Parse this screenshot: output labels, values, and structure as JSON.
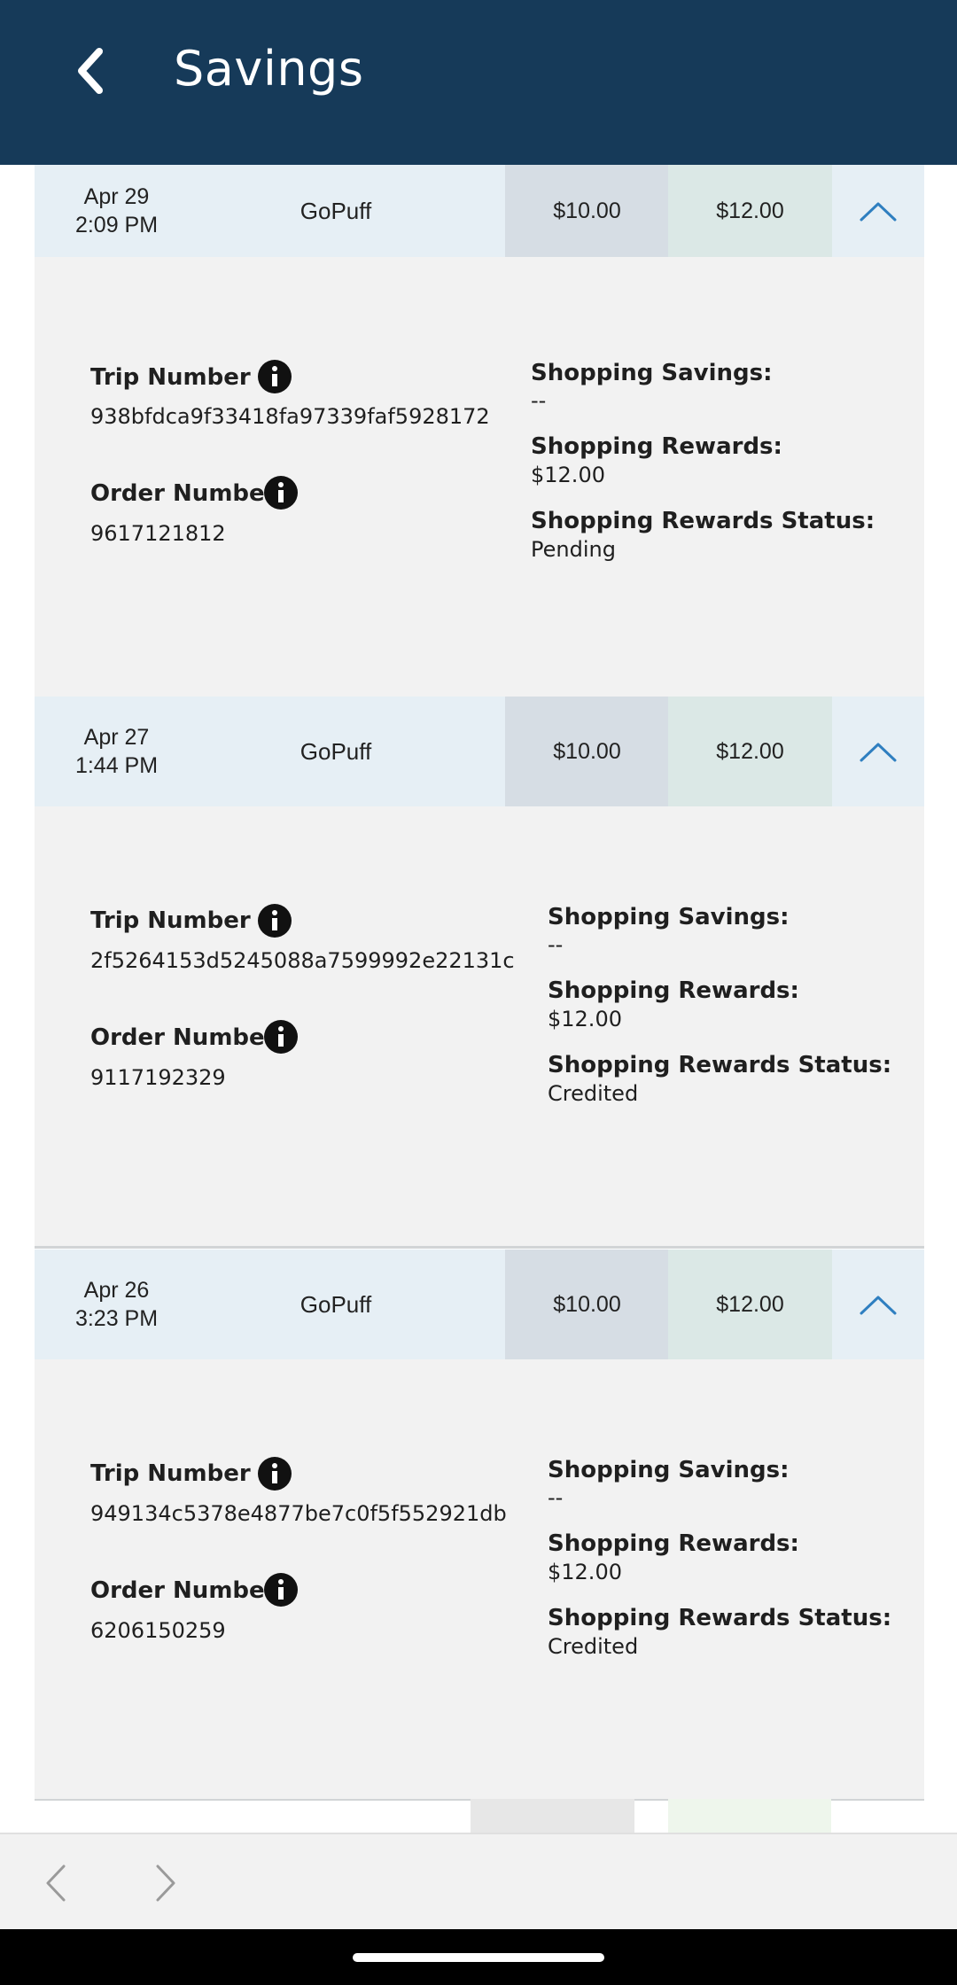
{
  "header": {
    "title": "Savings",
    "back_icon": "chevron-left-icon"
  },
  "trips": [
    {
      "date": "Apr 29",
      "time": "2:09 PM",
      "merchant": "GoPuff",
      "savings_amount": "$10.00",
      "rewards_amount": "$12.00",
      "trip_number_label": "Trip Number",
      "trip_number": "938bfdca9f33418fa97339faf5928172",
      "order_number_label": "Order Number",
      "order_number": "9617121812",
      "shopping_savings_label": "Shopping Savings:",
      "shopping_savings": "--",
      "shopping_rewards_label": "Shopping Rewards:",
      "shopping_rewards": "$12.00",
      "rewards_status_label": "Shopping Rewards Status:",
      "rewards_status": "Pending"
    },
    {
      "date": "Apr 27",
      "time": "1:44 PM",
      "merchant": "GoPuff",
      "savings_amount": "$10.00",
      "rewards_amount": "$12.00",
      "trip_number_label": "Trip Number",
      "trip_number": "2f5264153d5245088a7599992e22131c",
      "order_number_label": "Order Number",
      "order_number": "9117192329",
      "shopping_savings_label": "Shopping Savings:",
      "shopping_savings": "--",
      "shopping_rewards_label": "Shopping Rewards:",
      "shopping_rewards": "$12.00",
      "rewards_status_label": "Shopping Rewards Status:",
      "rewards_status": "Credited"
    },
    {
      "date": "Apr 26",
      "time": "3:23 PM",
      "merchant": "GoPuff",
      "savings_amount": "$10.00",
      "rewards_amount": "$12.00",
      "trip_number_label": "Trip Number",
      "trip_number": "949134c5378e4877be7c0f5f552921db",
      "order_number_label": "Order Number",
      "order_number": "6206150259",
      "shopping_savings_label": "Shopping Savings:",
      "shopping_savings": "--",
      "shopping_rewards_label": "Shopping Rewards:",
      "shopping_rewards": "$12.00",
      "rewards_status_label": "Shopping Rewards Status:",
      "rewards_status": "Credited"
    }
  ],
  "bottom_nav": {
    "back_icon": "browser-back-icon",
    "forward_icon": "browser-forward-icon"
  },
  "colors": {
    "header_bg": "#163a59",
    "row_bg": "#e6eff5",
    "savings_col": "#d6dde4",
    "rewards_col": "#dbe8e6",
    "chevron": "#2f7fc0"
  }
}
